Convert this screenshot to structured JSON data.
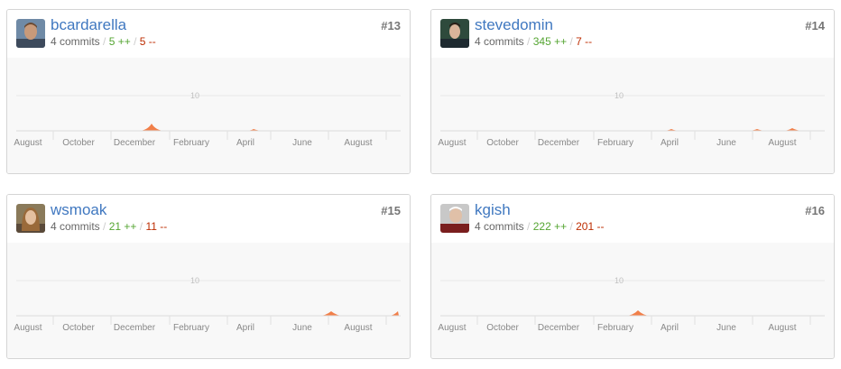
{
  "accent_link": "#4078c0",
  "addition_color": "#55a532",
  "deletion_color": "#bd2c00",
  "area_color": "#f17f49",
  "contributors": [
    {
      "username": "bcardarella",
      "commits": "4 commits",
      "additions": "5 ++",
      "deletions": "5 --",
      "rank": "#13",
      "y_tick": "10",
      "x_labels": [
        "August",
        "October",
        "December",
        "February",
        "April",
        "June",
        "August"
      ],
      "chart_data": {
        "type": "area",
        "x": [
          "August",
          "October",
          "December",
          "February",
          "April",
          "June",
          "August"
        ],
        "series": [
          {
            "name": "",
            "peaks": [
              {
                "at": "December",
                "value": 2
              },
              {
                "at": "April",
                "value": 0.5
              }
            ]
          }
        ],
        "yticks": [
          10
        ]
      }
    },
    {
      "username": "stevedomin",
      "commits": "4 commits",
      "additions": "345 ++",
      "deletions": "7 --",
      "rank": "#14",
      "y_tick": "10",
      "x_labels": [
        "August",
        "October",
        "December",
        "February",
        "April",
        "June",
        "August"
      ],
      "chart_data": {
        "type": "area",
        "x": [
          "August",
          "October",
          "December",
          "February",
          "April",
          "June",
          "August"
        ],
        "series": [
          {
            "name": "",
            "peaks": [
              {
                "at": "April",
                "value": 0.5
              },
              {
                "at": "July",
                "value": 0.6
              },
              {
                "at": "August",
                "value": 1
              }
            ]
          }
        ],
        "yticks": [
          10
        ]
      }
    },
    {
      "username": "wsmoak",
      "commits": "4 commits",
      "additions": "21 ++",
      "deletions": "11 --",
      "rank": "#15",
      "y_tick": "10",
      "x_labels": [
        "August",
        "October",
        "December",
        "February",
        "April",
        "June",
        "August"
      ],
      "chart_data": {
        "type": "area",
        "x": [
          "August",
          "October",
          "December",
          "February",
          "April",
          "June",
          "August"
        ],
        "series": [
          {
            "name": "",
            "peaks": [
              {
                "at": "July",
                "value": 1
              },
              {
                "at": "October",
                "value": 1
              }
            ]
          }
        ],
        "yticks": [
          10
        ]
      }
    },
    {
      "username": "kgish",
      "commits": "4 commits",
      "additions": "222 ++",
      "deletions": "201 --",
      "rank": "#16",
      "y_tick": "10",
      "x_labels": [
        "August",
        "October",
        "December",
        "February",
        "April",
        "June",
        "August"
      ],
      "chart_data": {
        "type": "area",
        "x": [
          "August",
          "October",
          "December",
          "February",
          "April",
          "June",
          "August"
        ],
        "series": [
          {
            "name": "",
            "peaks": [
              {
                "at": "March",
                "value": 1.5
              }
            ]
          }
        ],
        "yticks": [
          10
        ]
      }
    }
  ]
}
